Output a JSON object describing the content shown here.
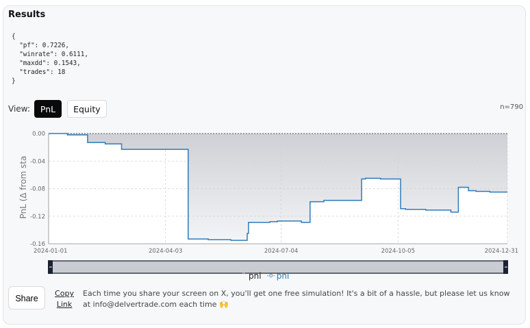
{
  "results": {
    "title": "Results",
    "json_text": "{\n  \"pf\": 0.7226,\n  \"winrate\": 0.6111,\n  \"maxdd\": 0.1543,\n  \"trades\": 18\n}"
  },
  "view": {
    "label": "View:",
    "tabs": [
      {
        "label": "PnL",
        "active": true
      },
      {
        "label": "Equity",
        "active": false
      }
    ],
    "n_label": "n=790"
  },
  "legend": {
    "items": [
      {
        "marker": "^",
        "label": "pnl"
      },
      {
        "marker": "-o-",
        "label": "pnl"
      }
    ]
  },
  "footer": {
    "share_label": "Share",
    "copy_label": "Copy Link",
    "notice": "Each time you share your screen on X, you'll get one free simulation! It's a bit of a hassle, but please let us know at info@delvertrade.com each time 🙌"
  },
  "colors": {
    "line": "#2f7ab8",
    "area": "#d6d7db",
    "grid": "#cfd2d6",
    "range_fill": "#c9ccd2"
  },
  "chart_data": {
    "type": "line",
    "ylabel": "PnL (Δ from sta",
    "xlabel": "",
    "ylim": [
      -0.16,
      0.0
    ],
    "yticks": [
      "0.00",
      "-0.04",
      "-0.08",
      "-0.12",
      "-0.16"
    ],
    "xticks": [
      "2024-01-01",
      "2024-04-03",
      "2024-07-04",
      "2024-10-05",
      "2024-12-31"
    ],
    "grid": true,
    "series": [
      {
        "name": "pnl",
        "step": true,
        "points": [
          [
            "2024-01-01",
            0.0
          ],
          [
            "2024-01-16",
            -0.002
          ],
          [
            "2024-02-01",
            -0.013
          ],
          [
            "2024-02-15",
            -0.015
          ],
          [
            "2024-02-28",
            -0.023
          ],
          [
            "2024-04-21",
            -0.153
          ],
          [
            "2024-05-07",
            -0.154
          ],
          [
            "2024-05-25",
            -0.155
          ],
          [
            "2024-06-07",
            -0.145
          ],
          [
            "2024-06-08",
            -0.129
          ],
          [
            "2024-06-25",
            -0.128
          ],
          [
            "2024-07-01",
            -0.127
          ],
          [
            "2024-07-20",
            -0.129
          ],
          [
            "2024-07-27",
            -0.099
          ],
          [
            "2024-08-07",
            -0.097
          ],
          [
            "2024-08-21",
            -0.097
          ],
          [
            "2024-09-06",
            -0.066
          ],
          [
            "2024-09-09",
            -0.065
          ],
          [
            "2024-09-21",
            -0.066
          ],
          [
            "2024-10-07",
            -0.109
          ],
          [
            "2024-10-11",
            -0.11
          ],
          [
            "2024-10-27",
            -0.111
          ],
          [
            "2024-11-16",
            -0.114
          ],
          [
            "2024-11-22",
            -0.078
          ],
          [
            "2024-11-30",
            -0.083
          ],
          [
            "2024-12-06",
            -0.084
          ],
          [
            "2024-12-17",
            -0.085
          ],
          [
            "2024-12-31",
            -0.085
          ]
        ]
      }
    ]
  }
}
